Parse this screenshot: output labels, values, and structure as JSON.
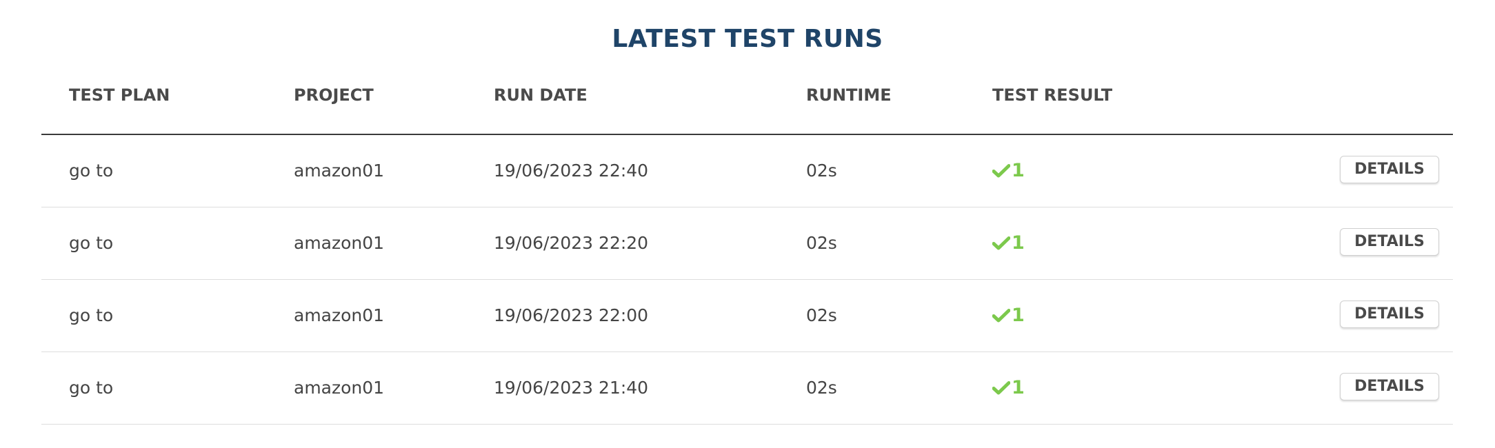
{
  "title": "LATEST TEST RUNS",
  "columns": {
    "test_plan": "TEST PLAN",
    "project": "PROJECT",
    "run_date": "RUN DATE",
    "runtime": "RUNTIME",
    "test_result": "TEST RESULT"
  },
  "colors": {
    "title": "#1f4468",
    "success": "#7cc94c",
    "text": "#444444"
  },
  "rows": [
    {
      "test_plan": "go to",
      "project": "amazon01",
      "run_date": "19/06/2023 22:40",
      "runtime": "02s",
      "result_icon": "check-icon",
      "result_count": "1",
      "action_label": "DETAILS"
    },
    {
      "test_plan": "go to",
      "project": "amazon01",
      "run_date": "19/06/2023 22:20",
      "runtime": "02s",
      "result_icon": "check-icon",
      "result_count": "1",
      "action_label": "DETAILS"
    },
    {
      "test_plan": "go to",
      "project": "amazon01",
      "run_date": "19/06/2023 22:00",
      "runtime": "02s",
      "result_icon": "check-icon",
      "result_count": "1",
      "action_label": "DETAILS"
    },
    {
      "test_plan": "go to",
      "project": "amazon01",
      "run_date": "19/06/2023 21:40",
      "runtime": "02s",
      "result_icon": "check-icon",
      "result_count": "1",
      "action_label": "DETAILS"
    }
  ]
}
